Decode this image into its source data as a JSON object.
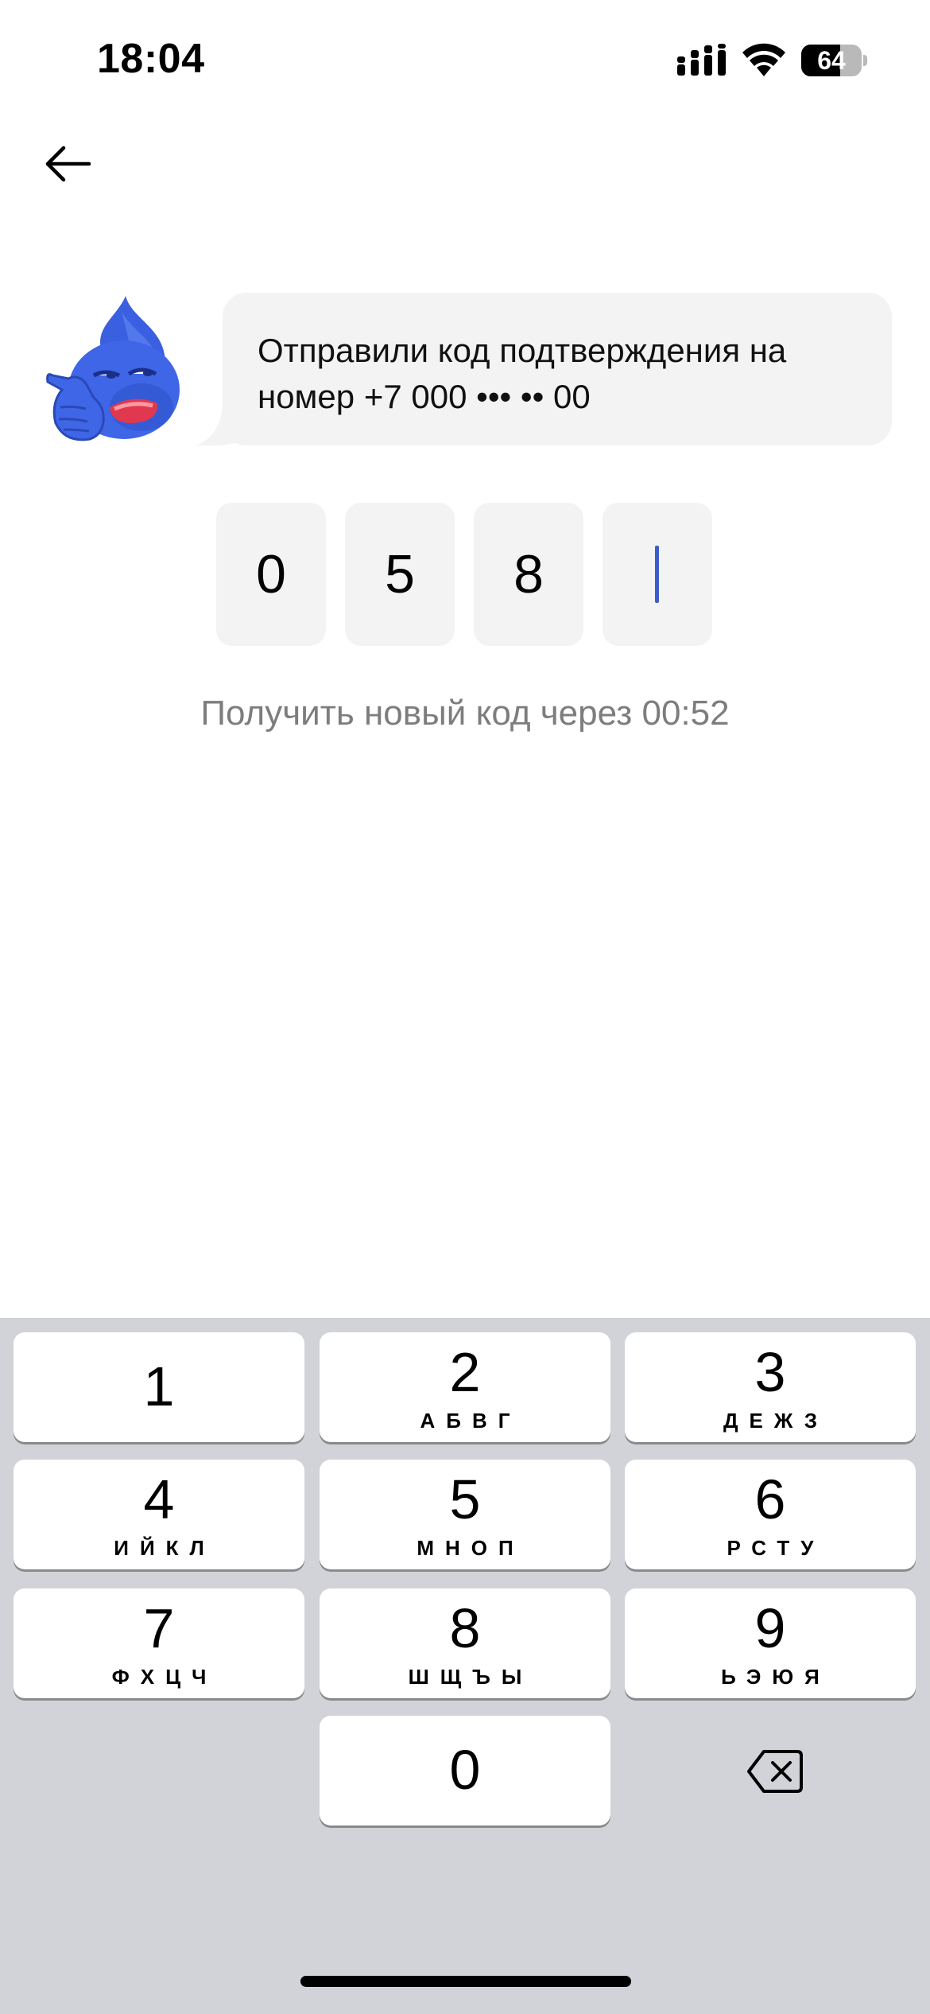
{
  "status_bar": {
    "time": "18:04",
    "battery_level": "64",
    "battery_fraction": 0.64,
    "icons": [
      "cellular-signal-icon",
      "wifi-icon",
      "battery-icon"
    ]
  },
  "nav": {
    "back_icon": "arrow-left-icon"
  },
  "message": {
    "line1": "Отправили код подтверждения на",
    "line2": "номер +7 000 ••• •• 00",
    "avatar": "blue-mascot-sticker"
  },
  "code": {
    "digits": [
      "0",
      "5",
      "8",
      ""
    ],
    "active_index": 3,
    "caret_color": "#3a5ccc"
  },
  "resend": {
    "text": "Получить новый код через 00:52"
  },
  "keypad": {
    "keys": [
      {
        "digit": "1",
        "letters": ""
      },
      {
        "digit": "2",
        "letters": "АБВГ"
      },
      {
        "digit": "3",
        "letters": "ДЕЖЗ"
      },
      {
        "digit": "4",
        "letters": "ИЙКЛ"
      },
      {
        "digit": "5",
        "letters": "МНОП"
      },
      {
        "digit": "6",
        "letters": "РСТУ"
      },
      {
        "digit": "7",
        "letters": "ФХЦЧ"
      },
      {
        "digit": "8",
        "letters": "ШЩЪЫ"
      },
      {
        "digit": "9",
        "letters": "ЬЭЮЯ"
      },
      {
        "digit": "0",
        "letters": ""
      }
    ],
    "backspace_icon": "backspace-icon"
  },
  "colors": {
    "bubble_bg": "#f3f3f3",
    "keypad_bg": "#d1d3d9",
    "muted_text": "#7d7d7d",
    "mascot_blue": "#3f66e6"
  }
}
